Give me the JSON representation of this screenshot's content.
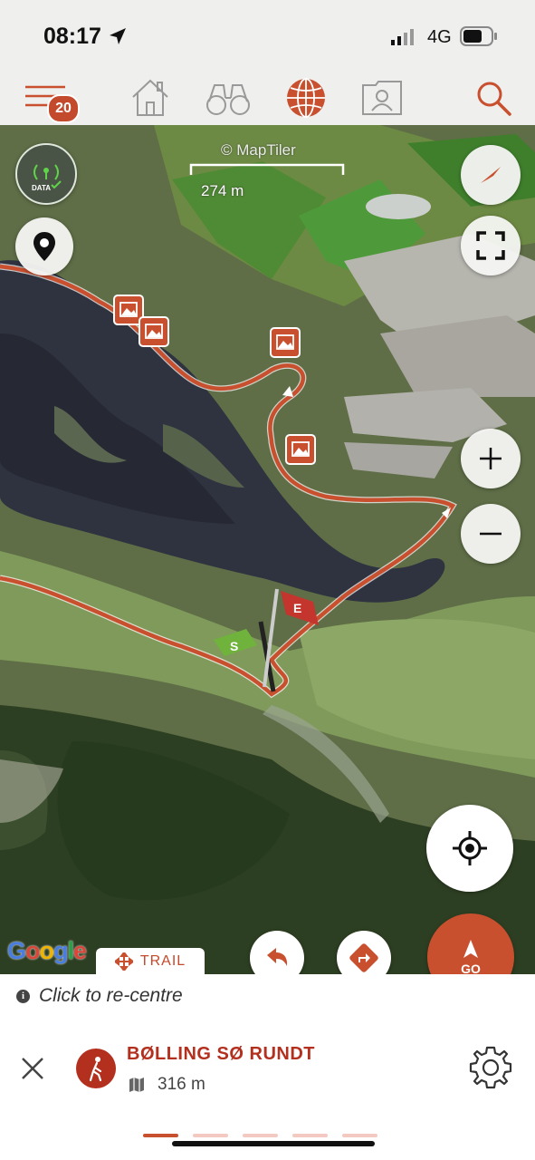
{
  "status_bar": {
    "time": "08:17",
    "network": "4G"
  },
  "toolbar": {
    "menu_badge": "20",
    "items": [
      {
        "name": "menu-icon",
        "active": false
      },
      {
        "name": "home-icon",
        "active": false
      },
      {
        "name": "binoculars-icon",
        "active": false
      },
      {
        "name": "globe-icon",
        "active": true
      },
      {
        "name": "profile-card-icon",
        "active": false
      },
      {
        "name": "search-icon",
        "active": false
      }
    ]
  },
  "map": {
    "attribution": "© MapTiler",
    "scale_label": "274 m",
    "provider_logo": "Google",
    "start_flag_label": "S",
    "end_flag_label": "E",
    "route_color": "#c8502f",
    "controls": [
      "data-sync-icon",
      "location-pin-icon",
      "compass-icon",
      "fullscreen-icon",
      "zoom-in-icon",
      "zoom-out-icon",
      "recenter-icon",
      "undo-icon",
      "directions-icon"
    ],
    "data_badge_label": "DATA"
  },
  "trail_tab": {
    "label": "TRAIL"
  },
  "go_button": {
    "label": "GO"
  },
  "panel": {
    "hint": "Click to re-centre",
    "route_name": "BØLLING SØ RUNDT",
    "distance": "316 m",
    "pager_count": 5,
    "pager_active": 0
  },
  "colors": {
    "accent": "#c8502f",
    "title_red": "#b3301e"
  }
}
